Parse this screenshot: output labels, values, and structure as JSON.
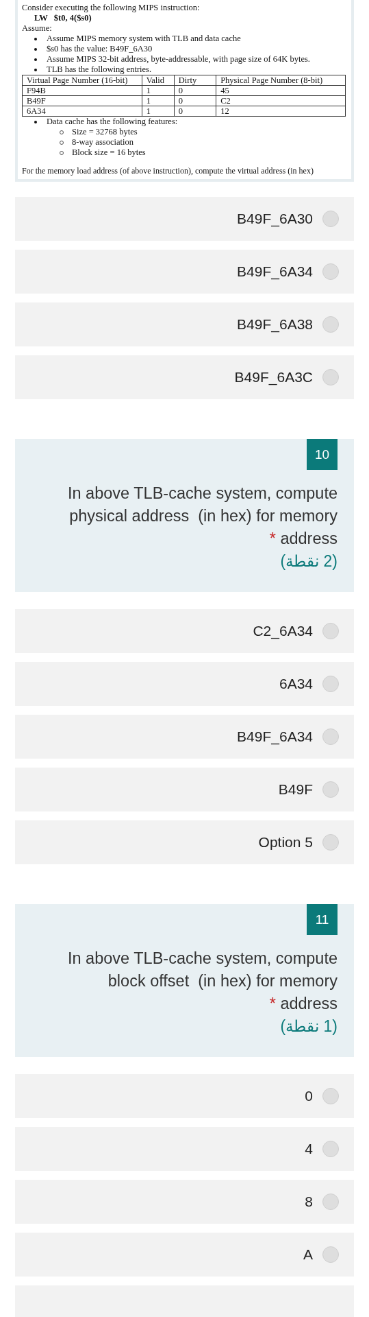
{
  "document": {
    "intro": "Consider executing the following MIPS instruction:",
    "instruction": "LW   $t0, 4($s0)",
    "assume_label": "Assume:",
    "bullets": [
      "Assume MIPS memory system with TLB and data cache",
      "$s0 has the value: B49F_6A30",
      "Assume MIPS 32-bit address, byte-addressable, with page size of 64K bytes.",
      "TLB has the following entries."
    ],
    "tlb_table": {
      "columns": [
        "Virtual Page Number (16-bit)",
        "Valid",
        "Dirty",
        "Physical Page Number  (8-bit)"
      ],
      "rows": [
        [
          "F94B",
          "1",
          "0",
          "45"
        ],
        [
          "B49F",
          "1",
          "0",
          "C2"
        ],
        [
          "6A34",
          "1",
          "0",
          "12"
        ]
      ]
    },
    "cache_bullet": "Data cache has the following features:",
    "cache_features": [
      "Size = 32768 bytes",
      "8-way association",
      "Block size = 16 bytes"
    ],
    "question": "For the memory load address (of above instruction), compute the virtual address (in hex)"
  },
  "sections": [
    {
      "options": [
        {
          "label": "B49F_6A30",
          "selected": false
        },
        {
          "label": "B49F_6A34",
          "selected": false
        },
        {
          "label": "B49F_6A38",
          "selected": false
        },
        {
          "label": "B49F_6A3C",
          "selected": false
        }
      ]
    },
    {
      "number": "10",
      "text": "In above TLB-cache system, compute physical address  (in hex) for memory address",
      "required_mark": "*",
      "points": "(2 نقطة)",
      "options": [
        {
          "label": "C2_6A34",
          "selected": false
        },
        {
          "label": "6A34",
          "selected": false
        },
        {
          "label": "B49F_6A34",
          "selected": false
        },
        {
          "label": "B49F",
          "selected": false
        },
        {
          "label": "Option 5",
          "selected": false
        }
      ]
    },
    {
      "number": "11",
      "text": "In above TLB-cache system, compute block offset  (in hex) for memory address",
      "required_mark": "*",
      "points": "(1 نقطة)",
      "options": [
        {
          "label": "0",
          "selected": false
        },
        {
          "label": "4",
          "selected": false
        },
        {
          "label": "8",
          "selected": false
        },
        {
          "label": "A",
          "selected": false
        }
      ]
    }
  ]
}
